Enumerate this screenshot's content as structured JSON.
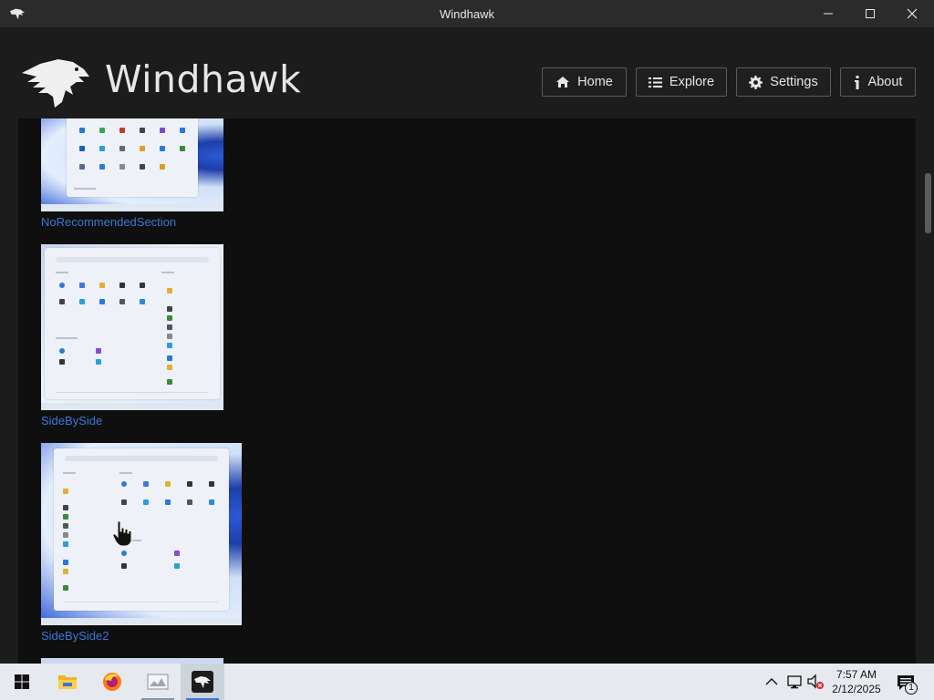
{
  "window": {
    "title": "Windhawk"
  },
  "header": {
    "logo_text": "Windhawk",
    "nav": [
      {
        "label": "Home",
        "icon": "home-icon"
      },
      {
        "label": "Explore",
        "icon": "list-icon"
      },
      {
        "label": "Settings",
        "icon": "gear-icon"
      },
      {
        "label": "About",
        "icon": "info-icon"
      }
    ]
  },
  "content": {
    "screenshots": [
      {
        "caption": "NoRecommendedSection"
      },
      {
        "caption": "SideBySide"
      },
      {
        "caption": "SideBySide2"
      }
    ]
  },
  "taskbar": {
    "apps": [
      "start-icon",
      "file-explorer-icon",
      "firefox-icon",
      "snipping-icon",
      "windhawk-icon"
    ],
    "tray_icons": [
      "chevron-up-icon",
      "network-icon",
      "volume-muted-icon",
      "notification-icon"
    ],
    "time": "7:57 AM",
    "date": "2/12/2025",
    "notification_count": "1"
  },
  "colors": {
    "accent_link": "#3b78d6",
    "background": "#1c1c1c",
    "panel": "#0f0f0f"
  }
}
